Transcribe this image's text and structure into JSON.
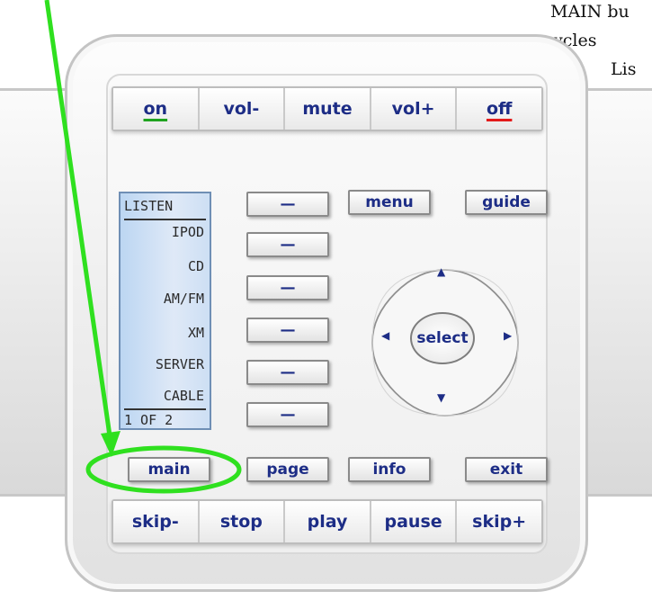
{
  "annotation": {
    "line1": "MAIN bu",
    "line2": "ton cycles",
    "line3": "Lis"
  },
  "top_row": [
    {
      "label": "on"
    },
    {
      "label": "vol-"
    },
    {
      "label": "mute"
    },
    {
      "label": "vol+"
    },
    {
      "label": "off"
    }
  ],
  "nav_buttons": {
    "menu": "menu",
    "guide": "guide"
  },
  "lcd": {
    "header": "LISTEN",
    "items": [
      "IPOD",
      "CD",
      "AM/FM",
      "XM",
      "SERVER",
      "CABLE"
    ],
    "page_indicator": "1 OF 2"
  },
  "soft_key_label": "—",
  "dpad": {
    "select": "select"
  },
  "bottom_buttons": {
    "main": "main",
    "page": "page",
    "info": "info",
    "exit": "exit"
  },
  "transport_row": [
    {
      "label": "skip-"
    },
    {
      "label": "stop"
    },
    {
      "label": "play"
    },
    {
      "label": "pause"
    },
    {
      "label": "skip+"
    }
  ],
  "colors": {
    "on_underline": "#1fa31f",
    "off_underline": "#e31b1b",
    "highlight": "#2fe01f",
    "label_text": "#1d2d86"
  },
  "icons": [
    "up-arrow-icon",
    "down-arrow-icon",
    "left-arrow-icon",
    "right-arrow-icon"
  ]
}
